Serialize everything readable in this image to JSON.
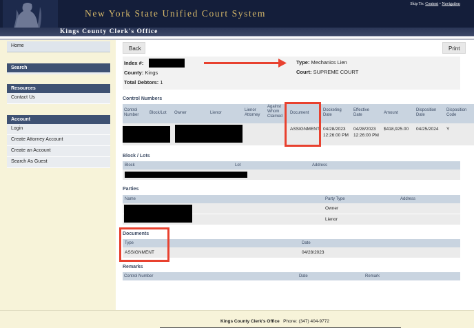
{
  "header": {
    "site_title": "New York State Unified Court System",
    "skip_prefix": "Skip To:",
    "skip_content": "Content",
    "skip_sep": "•",
    "skip_navigation": "Navigation",
    "office_title": "Kings County Clerk's Office"
  },
  "sidebar": {
    "home": "Home",
    "search_heading": "Search",
    "resources_heading": "Resources",
    "contact_us": "Contact Us",
    "account_heading": "Account",
    "account_links": [
      "Login",
      "Create Attorney Account",
      "Create an Account",
      "Search As Guest"
    ]
  },
  "toolbar": {
    "back_label": "Back",
    "print_label": "Print"
  },
  "info": {
    "index_label": "Index #:",
    "county_label": "County:",
    "county_value": "Kings",
    "debtors_label": "Total Debtors:",
    "debtors_value": "1",
    "type_label": "Type:",
    "type_value": "Mechanics Lien",
    "court_label": "Court:",
    "court_value": "SUPREME COURT"
  },
  "control_numbers": {
    "title": "Control Numbers",
    "headers": [
      "Control Number",
      "Block/Lot",
      "Owner",
      "Lienor",
      "Lienor Attorney",
      "Against Whom Claimed",
      "Document",
      "Docketing Date",
      "Effective Date",
      "Amount",
      "Disposition Date",
      "Disposition Code"
    ],
    "row": {
      "document": "ASSIGNMENT",
      "docketing_date": "04/28/2023 12:26:00 PM",
      "effective_date": "04/28/2023 12:26:00 PM",
      "amount": "$418,925.00",
      "disposition_date": "04/25/2024",
      "disposition_code": "Y"
    }
  },
  "block_lots": {
    "title": "Block / Lots",
    "headers": [
      "Block",
      "Lot",
      "Address"
    ]
  },
  "parties": {
    "title": "Parties",
    "headers": [
      "Name",
      "Party Type",
      "Address"
    ],
    "rows": [
      {
        "party_type": "Owner"
      },
      {
        "party_type": "Lienor"
      }
    ]
  },
  "documents": {
    "title": "Documents",
    "headers": [
      "Type",
      "Date"
    ],
    "row": {
      "type": "ASSIGNMENT",
      "date": "04/28/2023"
    }
  },
  "remarks": {
    "title": "Remarks",
    "headers": [
      "Control Number",
      "Date",
      "Remark"
    ]
  },
  "footer": {
    "office": "Kings County Clerk's Office",
    "phone": "Phone: (347) 404-9772"
  },
  "colors": {
    "header_bg": "#141e3a",
    "title_gold": "#d7b96a",
    "sidebar_bg": "#f7f3d9",
    "section_head": "#3e5173",
    "table_head": "#c9d4e0",
    "annotation_red": "#e8412f"
  }
}
